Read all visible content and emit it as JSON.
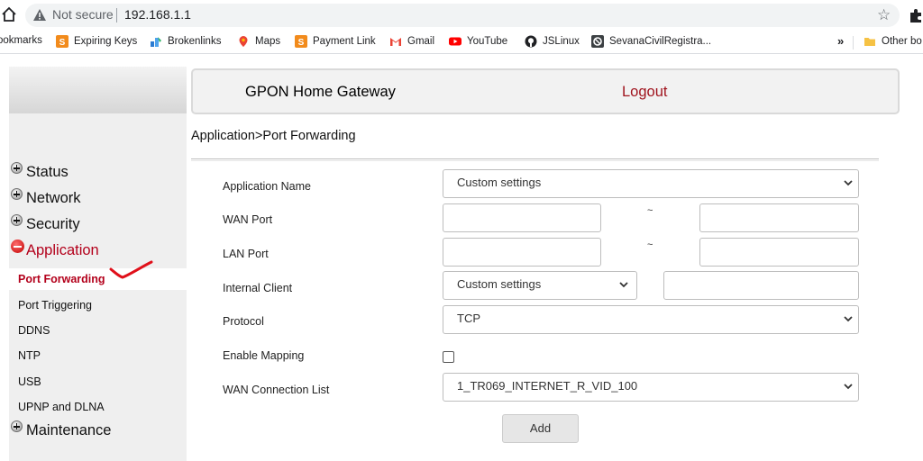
{
  "browser": {
    "security_label": "Not secure",
    "url": "192.168.1.1",
    "bookmarks": [
      {
        "label": "ookmarks",
        "icon": "none"
      },
      {
        "label": "Expiring Keys",
        "icon": "s-square-icon"
      },
      {
        "label": "Brokenlinks",
        "icon": "brokenlinks-icon"
      },
      {
        "label": "Maps",
        "icon": "map-pin-icon"
      },
      {
        "label": "Payment Link",
        "icon": "s-square-icon"
      },
      {
        "label": "Gmail",
        "icon": "gmail-icon"
      },
      {
        "label": "YouTube",
        "icon": "youtube-icon"
      },
      {
        "label": "JSLinux",
        "icon": "github-icon"
      },
      {
        "label": "SevanaCivilRegistra...",
        "icon": "sevana-icon"
      }
    ],
    "more_label": "»",
    "other_bookmarks_label": "Other bo"
  },
  "header": {
    "brand": "GPON Home Gateway",
    "logout": "Logout"
  },
  "breadcrumb": "Application>Port Forwarding",
  "sidebar": {
    "groups": {
      "status": "Status",
      "network": "Network",
      "security": "Security",
      "application": "Application",
      "maintenance": "Maintenance"
    },
    "application_items": [
      "Port Forwarding",
      "Port Triggering",
      "DDNS",
      "NTP",
      "USB",
      "UPNP and DLNA"
    ],
    "active_item": "Port Forwarding"
  },
  "form": {
    "application_name": {
      "label": "Application Name",
      "value": "Custom settings"
    },
    "wan_port": {
      "label": "WAN Port",
      "separator": "~",
      "start": "",
      "end": ""
    },
    "lan_port": {
      "label": "LAN Port",
      "separator": "~",
      "start": "",
      "end": ""
    },
    "internal_client": {
      "label": "Internal Client",
      "value": "Custom settings",
      "address": ""
    },
    "protocol": {
      "label": "Protocol",
      "value": "TCP"
    },
    "enable_mapping": {
      "label": "Enable Mapping",
      "checked": false
    },
    "wan_connection_list": {
      "label": "WAN Connection List",
      "value": "1_TR069_INTERNET_R_VID_100"
    },
    "add_button": "Add"
  },
  "colors": {
    "accent_red": "#b3001b",
    "logout_red": "#a0141e",
    "sidebar_bg": "#efefef",
    "annotation_red": "#e0101a"
  }
}
